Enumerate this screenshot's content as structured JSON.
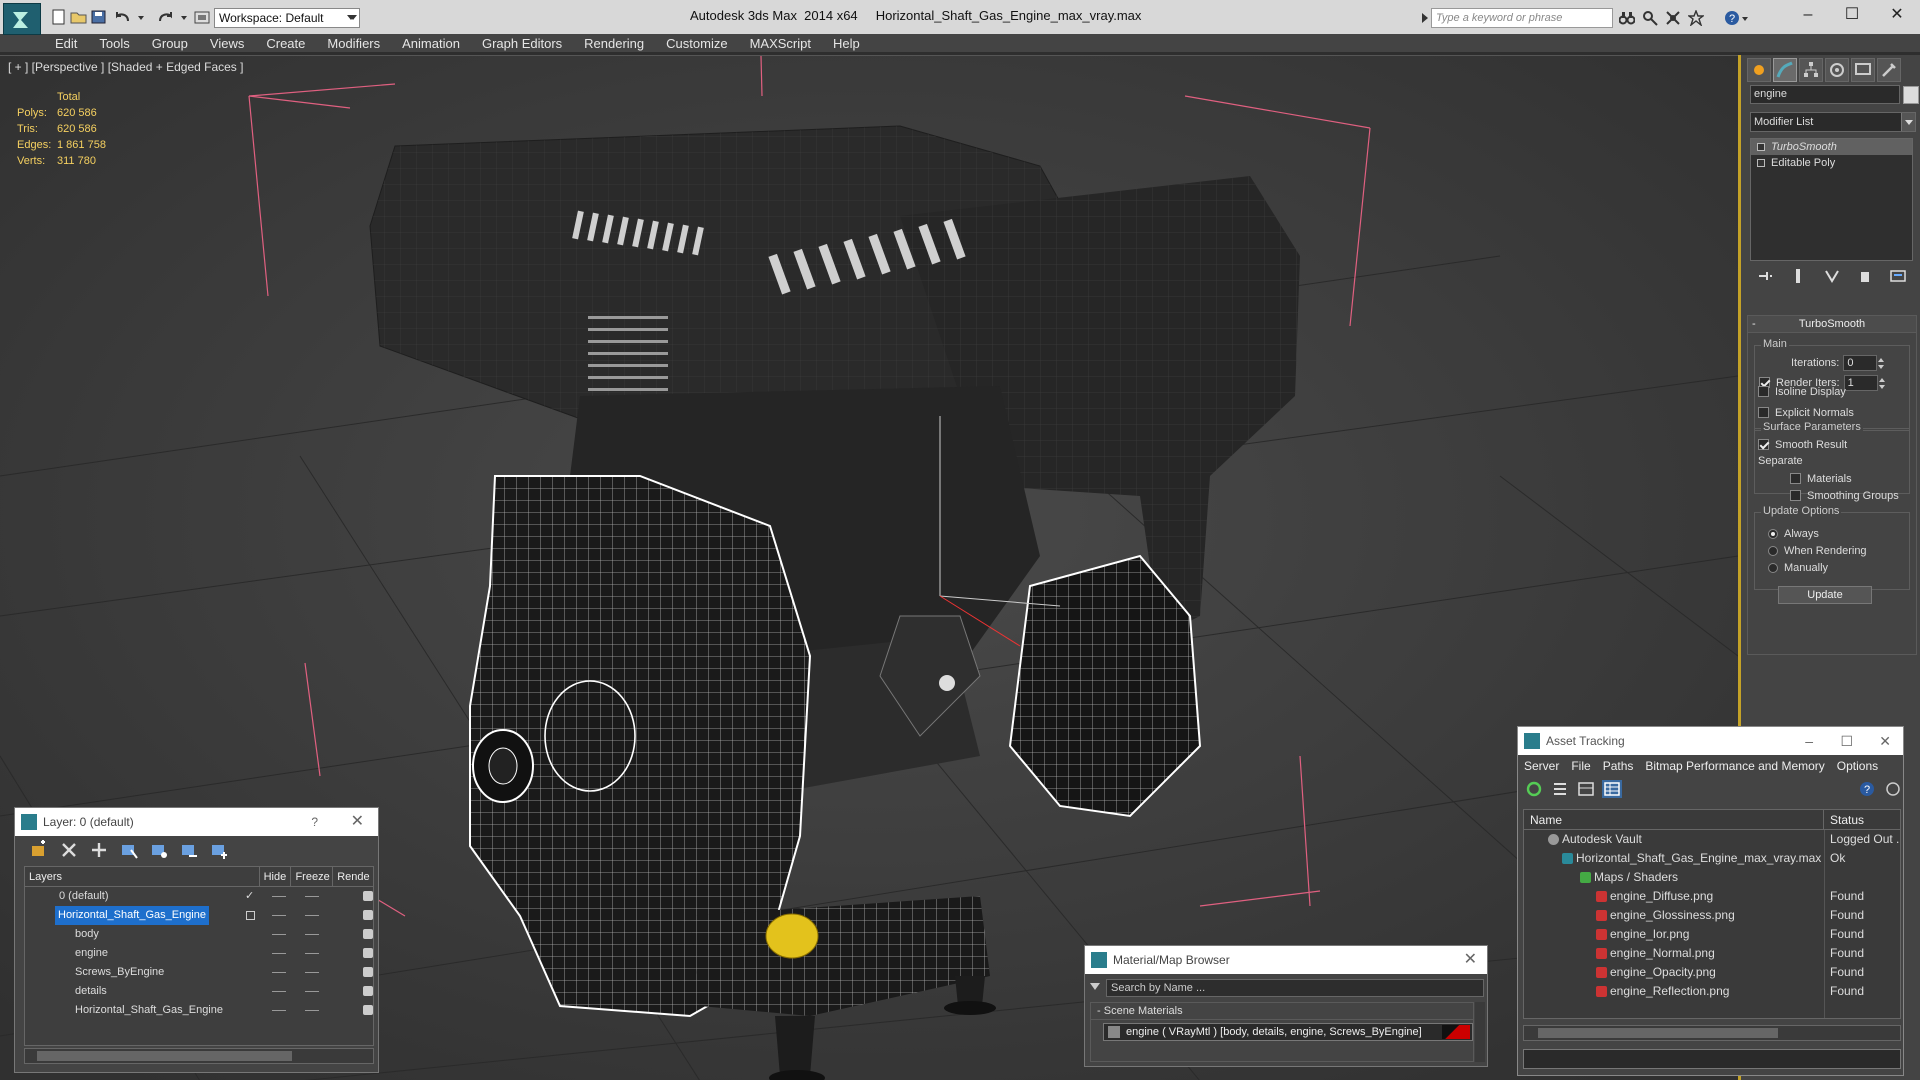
{
  "app": {
    "title": "Autodesk 3ds Max  2014 x64     Horizontal_Shaft_Gas_Engine_max_vray.max",
    "workspace": "Workspace: Default",
    "search_placeholder": "Type a keyword or phrase"
  },
  "menu": [
    "Edit",
    "Tools",
    "Group",
    "Views",
    "Create",
    "Modifiers",
    "Animation",
    "Graph Editors",
    "Rendering",
    "Customize",
    "MAXScript",
    "Help"
  ],
  "viewport": {
    "label": "[ + ] [Perspective ] [Shaded + Edged Faces ]",
    "stats": {
      "header": "Total",
      "rows": [
        {
          "k": "Polys:",
          "v": "620 586"
        },
        {
          "k": "Tris:",
          "v": "620 586"
        },
        {
          "k": "Edges:",
          "v": "1 861 758"
        },
        {
          "k": "Verts:",
          "v": "311 780"
        }
      ]
    }
  },
  "command_panel": {
    "object_name": "engine",
    "modifier_list": "Modifier List",
    "stack": [
      {
        "label": "TurboSmooth",
        "selected": true
      },
      {
        "label": "Editable Poly",
        "selected": false
      }
    ],
    "rollout_title": "TurboSmooth",
    "main_group": "Main",
    "iterations_label": "Iterations:",
    "iterations_value": "0",
    "render_iters_label": "Render Iters:",
    "render_iters_value": "1",
    "isoline": "Isoline Display",
    "explicit": "Explicit Normals",
    "surface_group": "Surface Parameters",
    "smooth_result": "Smooth Result",
    "separate": "Separate",
    "materials": "Materials",
    "smoothing_groups": "Smoothing Groups",
    "update_group": "Update Options",
    "always": "Always",
    "when_rendering": "When Rendering",
    "manually": "Manually",
    "update_button": "Update"
  },
  "layer_panel": {
    "title": "Layer: 0 (default)",
    "help": "?",
    "cols": {
      "layers": "Layers",
      "hide": "Hide",
      "freeze": "Freeze",
      "render": "Rende"
    },
    "rows": [
      {
        "name": "0 (default)",
        "indent": 0
      },
      {
        "name": "Horizontal_Shaft_Gas_Engine",
        "indent": 0
      },
      {
        "name": "body",
        "indent": 1
      },
      {
        "name": "engine",
        "indent": 1
      },
      {
        "name": "Screws_ByEngine",
        "indent": 1
      },
      {
        "name": "details",
        "indent": 1
      },
      {
        "name": "Horizontal_Shaft_Gas_Engine",
        "indent": 1
      }
    ]
  },
  "material_browser": {
    "title": "Material/Map Browser",
    "search": "Search by Name ...",
    "section": "Scene Materials",
    "item": "engine  ( VRayMtl )  [body, details, engine, Screws_ByEngine]"
  },
  "asset_tracking": {
    "title": "Asset Tracking",
    "menu": [
      "Server",
      "File",
      "Paths",
      "Bitmap Performance and Memory",
      "Options"
    ],
    "cols": {
      "name": "Name",
      "status": "Status"
    },
    "rows": [
      {
        "name": "Autodesk Vault",
        "status": "Logged Out ...",
        "indent": 1,
        "icon": "vault"
      },
      {
        "name": "Horizontal_Shaft_Gas_Engine_max_vray.max",
        "status": "Ok",
        "indent": 2,
        "icon": "max"
      },
      {
        "name": "Maps / Shaders",
        "status": "",
        "indent": 3,
        "icon": "folder"
      },
      {
        "name": "engine_Diffuse.png",
        "status": "Found",
        "indent": 4,
        "icon": "png"
      },
      {
        "name": "engine_Glossiness.png",
        "status": "Found",
        "indent": 4,
        "icon": "png"
      },
      {
        "name": "engine_Ior.png",
        "status": "Found",
        "indent": 4,
        "icon": "png"
      },
      {
        "name": "engine_Normal.png",
        "status": "Found",
        "indent": 4,
        "icon": "png"
      },
      {
        "name": "engine_Opacity.png",
        "status": "Found",
        "indent": 4,
        "icon": "png"
      },
      {
        "name": "engine_Reflection.png",
        "status": "Found",
        "indent": 4,
        "icon": "png"
      }
    ]
  },
  "colors": {
    "accent": "#c4a227",
    "selection": "#1e6fcc",
    "stats": "#f5d060",
    "bbox": "#e06080"
  }
}
